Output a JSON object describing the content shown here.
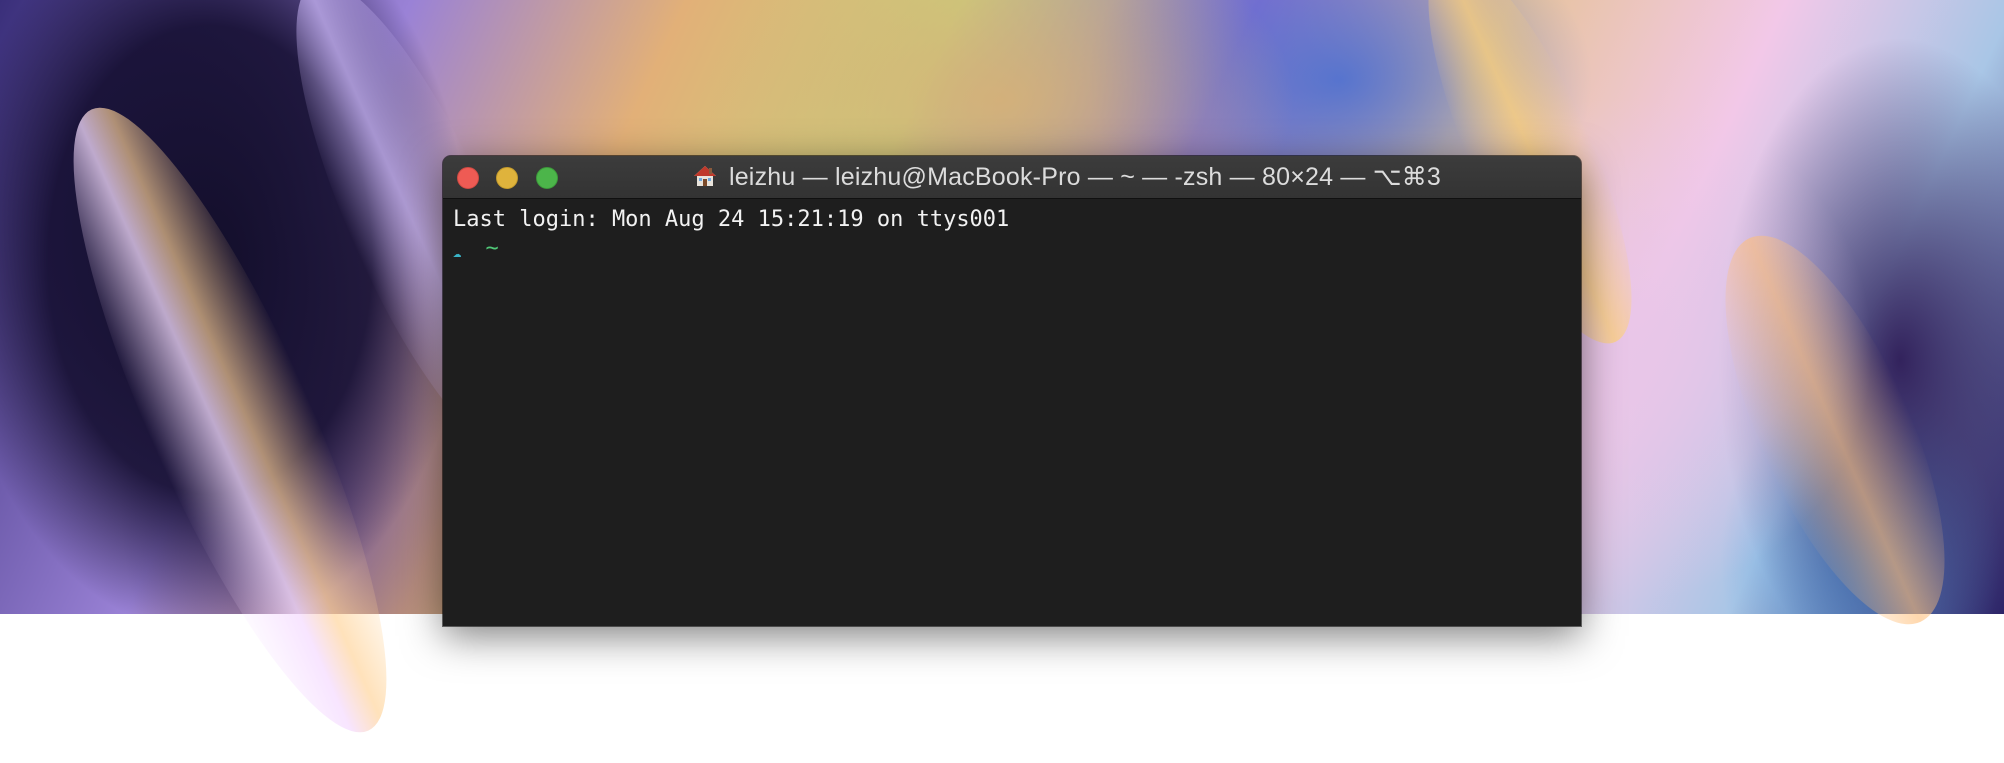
{
  "window": {
    "title": "leizhu — leizhu@MacBook-Pro — ~ — -zsh — 80×24 — ⌥⌘3",
    "icon": "home-icon"
  },
  "controls": {
    "close": "close-button",
    "minimize": "minimize-button",
    "zoom": "zoom-button"
  },
  "terminal": {
    "last_login": "Last login: Mon Aug 24 15:21:19 on ttys001",
    "prompt_symbol": "☁",
    "prompt_dir": "~"
  },
  "colors": {
    "terminal_bg": "#1e1e1e",
    "prompt_symbol": "#39b4c7",
    "prompt_dir": "#50c878",
    "text": "#f2f2f2"
  }
}
